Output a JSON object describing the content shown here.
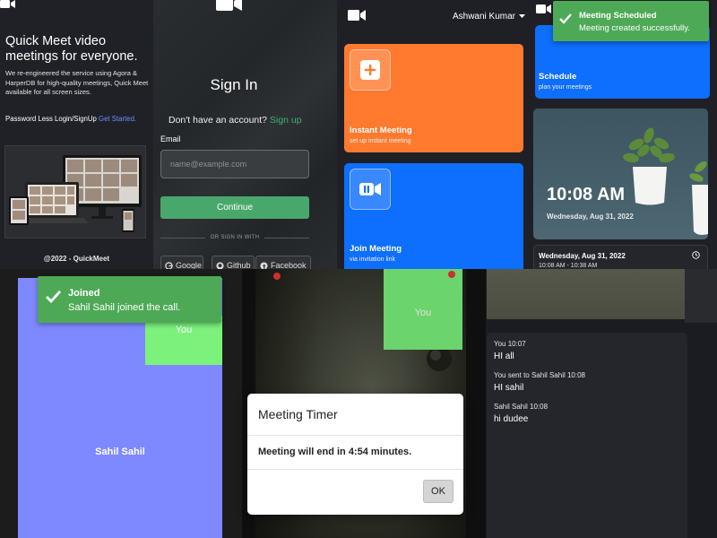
{
  "landing": {
    "headline": "Quick Meet video meetings for everyone.",
    "description": "We re-engineered the service using Agora & HarperDB for high-quality meetings, Quick Meet available for all screen sizes.",
    "login_prefix": "Password Less Login/SignUp",
    "get_started": "Get Started.",
    "footer": "@2022 - QuickMeet",
    "icons": [
      "video-camera-icon",
      "devices-illustration"
    ]
  },
  "signin": {
    "title": "Sign In",
    "no_account": "Don't have an account?",
    "signup_link": "Sign up",
    "email_label": "Email",
    "email_placeholder": "name@example.com",
    "email_value": "",
    "continue_label": "Continue",
    "divider_text": "OR SIGN IN WITH",
    "providers": [
      "Google",
      "Github",
      "Facebook"
    ],
    "colors": {
      "accent": "#48a86c",
      "link": "#3fb171"
    }
  },
  "dashboard": {
    "user_name": "Ashwani Kumar",
    "instant_title": "Instant Meeting",
    "instant_sub": "set up instant meeting",
    "join_title": "Join Meeting",
    "join_sub": "via invitation link",
    "colors": {
      "instant": "#ff7a2f",
      "join": "#0e6efd"
    }
  },
  "schedule": {
    "title": "Schedule",
    "sub": "plan your meetings",
    "time": "10:08 AM",
    "date": "Wednesday, Aug 31, 2022",
    "meeting_date": "Wednesday, Aug 31, 2022",
    "meeting_time": "10:08 AM - 10:38 AM"
  },
  "toast_scheduled": {
    "title": "Meeting Scheduled",
    "body": "Meeting created successfully."
  },
  "call": {
    "participant_name": "Sahil Sahil",
    "self_label": "You",
    "colors": {
      "participant_tile": "#7e89ff",
      "self_tile": "#7cf27d"
    }
  },
  "toast_joined": {
    "title": "Joined",
    "body": "Sahil Sahil joined the call."
  },
  "timer_call": {
    "self_label": "You"
  },
  "timer_dialog": {
    "title": "Meeting Timer",
    "message": "Meeting will end in 4:54 minutes.",
    "ok_label": "OK"
  },
  "chat": {
    "messages": [
      {
        "meta": "You 10:07",
        "text": "HI all"
      },
      {
        "meta": "You sent to Sahil Sahil 10:08",
        "text": "HI sahil"
      },
      {
        "meta": "Sahil Sahil 10:08",
        "text": "hi dudee"
      }
    ]
  }
}
